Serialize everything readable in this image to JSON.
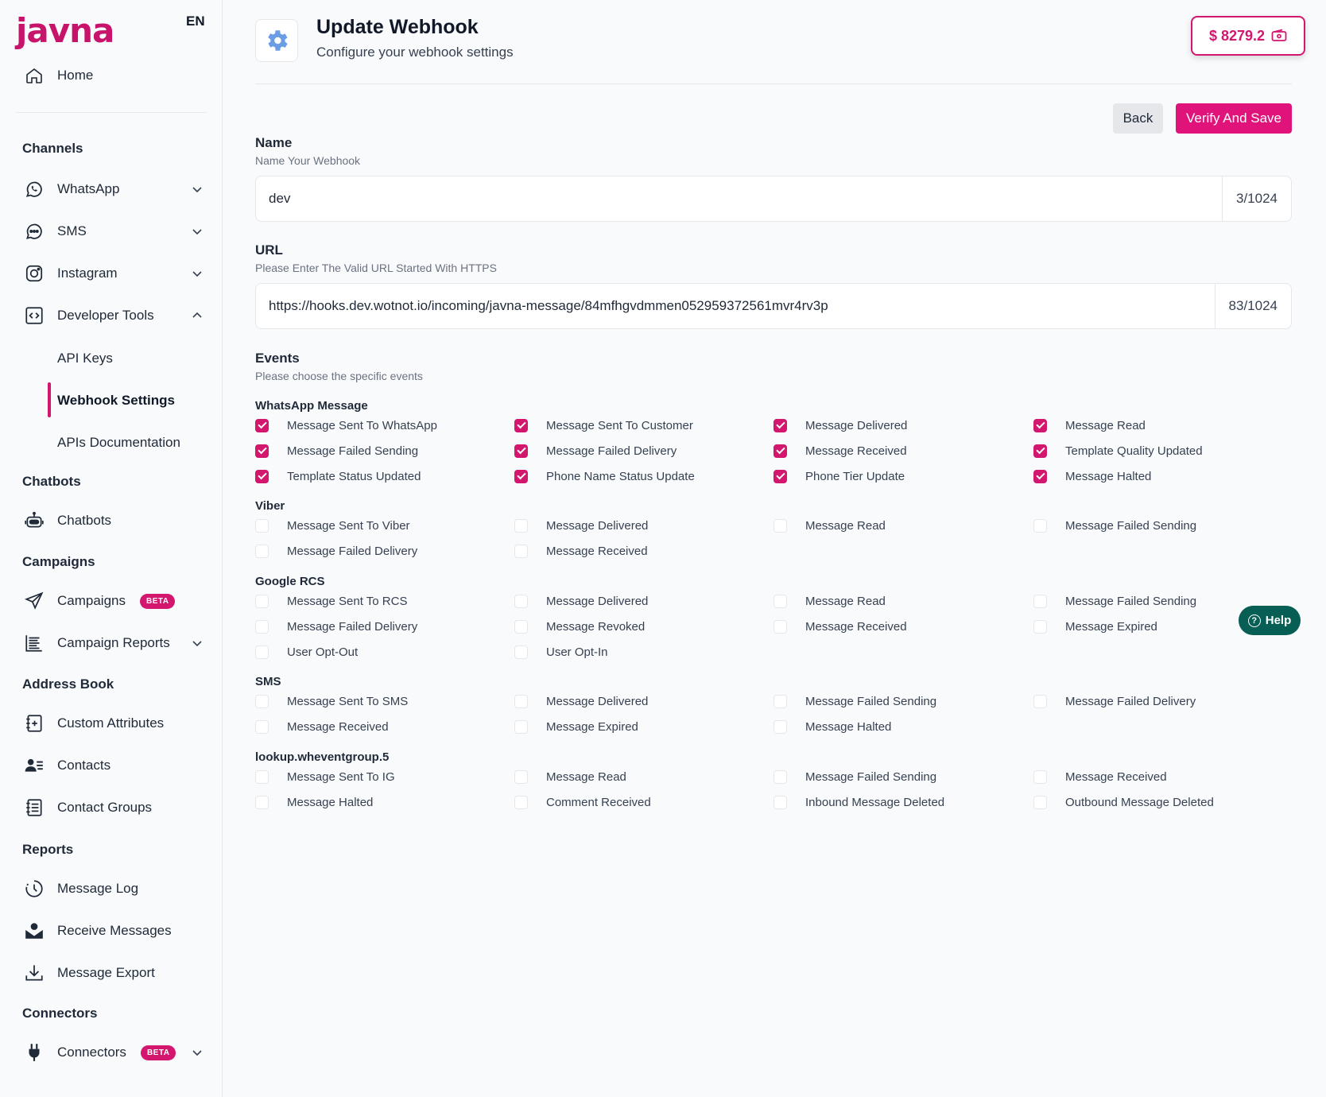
{
  "sidebar": {
    "logo": "javna",
    "lang": "EN",
    "home": "Home",
    "sections": {
      "channels": "Channels",
      "chatbots": "Chatbots",
      "campaigns": "Campaigns",
      "address_book": "Address Book",
      "reports": "Reports",
      "connectors": "Connectors"
    },
    "items": {
      "whatsapp": "WhatsApp",
      "sms": "SMS",
      "instagram": "Instagram",
      "developer_tools": "Developer Tools",
      "api_keys": "API Keys",
      "webhook_settings": "Webhook Settings",
      "apis_documentation": "APIs Documentation",
      "chatbots": "Chatbots",
      "campaigns": "Campaigns",
      "campaign_reports": "Campaign Reports",
      "custom_attributes": "Custom Attributes",
      "contacts": "Contacts",
      "contact_groups": "Contact Groups",
      "message_log": "Message Log",
      "receive_messages": "Receive Messages",
      "message_export": "Message Export",
      "connectors": "Connectors"
    },
    "beta_label": "BETA"
  },
  "header": {
    "title": "Update Webhook",
    "subtitle": "Configure your webhook settings",
    "balance": "$ 8279.2"
  },
  "actions": {
    "back": "Back",
    "save": "Verify And Save"
  },
  "form": {
    "name": {
      "label": "Name",
      "help": "Name Your Webhook",
      "value": "dev",
      "counter": "3/1024"
    },
    "url": {
      "label": "URL",
      "help": "Please Enter The Valid URL Started With HTTPS",
      "value": "https://hooks.dev.wotnot.io/incoming/javna-message/84mfhgvdmmen052959372561mvr4rv3p",
      "counter": "83/1024"
    },
    "events": {
      "label": "Events",
      "help": "Please choose the specific events"
    }
  },
  "groups": [
    {
      "title": "WhatsApp Message",
      "events": [
        {
          "label": "Message Sent To WhatsApp",
          "checked": true
        },
        {
          "label": "Message Sent To Customer",
          "checked": true
        },
        {
          "label": "Message Delivered",
          "checked": true
        },
        {
          "label": "Message Read",
          "checked": true
        },
        {
          "label": "Message Failed Sending",
          "checked": true
        },
        {
          "label": "Message Failed Delivery",
          "checked": true
        },
        {
          "label": "Message Received",
          "checked": true
        },
        {
          "label": "Template Quality Updated",
          "checked": true
        },
        {
          "label": "Template Status Updated",
          "checked": true
        },
        {
          "label": "Phone Name Status Update",
          "checked": true
        },
        {
          "label": "Phone Tier Update",
          "checked": true
        },
        {
          "label": "Message Halted",
          "checked": true
        }
      ]
    },
    {
      "title": "Viber",
      "events": [
        {
          "label": "Message Sent To Viber",
          "checked": false
        },
        {
          "label": "Message Delivered",
          "checked": false
        },
        {
          "label": "Message Read",
          "checked": false
        },
        {
          "label": "Message Failed Sending",
          "checked": false
        },
        {
          "label": "Message Failed Delivery",
          "checked": false
        },
        {
          "label": "Message Received",
          "checked": false
        }
      ]
    },
    {
      "title": "Google RCS",
      "events": [
        {
          "label": "Message Sent To RCS",
          "checked": false
        },
        {
          "label": "Message Delivered",
          "checked": false
        },
        {
          "label": "Message Read",
          "checked": false
        },
        {
          "label": "Message Failed Sending",
          "checked": false
        },
        {
          "label": "Message Failed Delivery",
          "checked": false
        },
        {
          "label": "Message Revoked",
          "checked": false
        },
        {
          "label": "Message Received",
          "checked": false
        },
        {
          "label": "Message Expired",
          "checked": false
        },
        {
          "label": "User Opt-Out",
          "checked": false
        },
        {
          "label": "User Opt-In",
          "checked": false
        }
      ]
    },
    {
      "title": "SMS",
      "events": [
        {
          "label": "Message Sent To SMS",
          "checked": false
        },
        {
          "label": "Message Delivered",
          "checked": false
        },
        {
          "label": "Message Failed Sending",
          "checked": false
        },
        {
          "label": "Message Failed Delivery",
          "checked": false
        },
        {
          "label": "Message Received",
          "checked": false
        },
        {
          "label": "Message Expired",
          "checked": false
        },
        {
          "label": "Message Halted",
          "checked": false
        }
      ]
    },
    {
      "title": "lookup.wheventgroup.5",
      "events": [
        {
          "label": "Message Sent To IG",
          "checked": false
        },
        {
          "label": "Message Read",
          "checked": false
        },
        {
          "label": "Message Failed Sending",
          "checked": false
        },
        {
          "label": "Message Received",
          "checked": false
        },
        {
          "label": "Message Halted",
          "checked": false
        },
        {
          "label": "Comment Received",
          "checked": false
        },
        {
          "label": "Inbound Message Deleted",
          "checked": false
        },
        {
          "label": "Outbound Message Deleted",
          "checked": false
        }
      ]
    }
  ],
  "help": {
    "label": "Help"
  },
  "colors": {
    "accent": "#d3166e",
    "help": "#075e54",
    "brand": "#c8136b"
  }
}
